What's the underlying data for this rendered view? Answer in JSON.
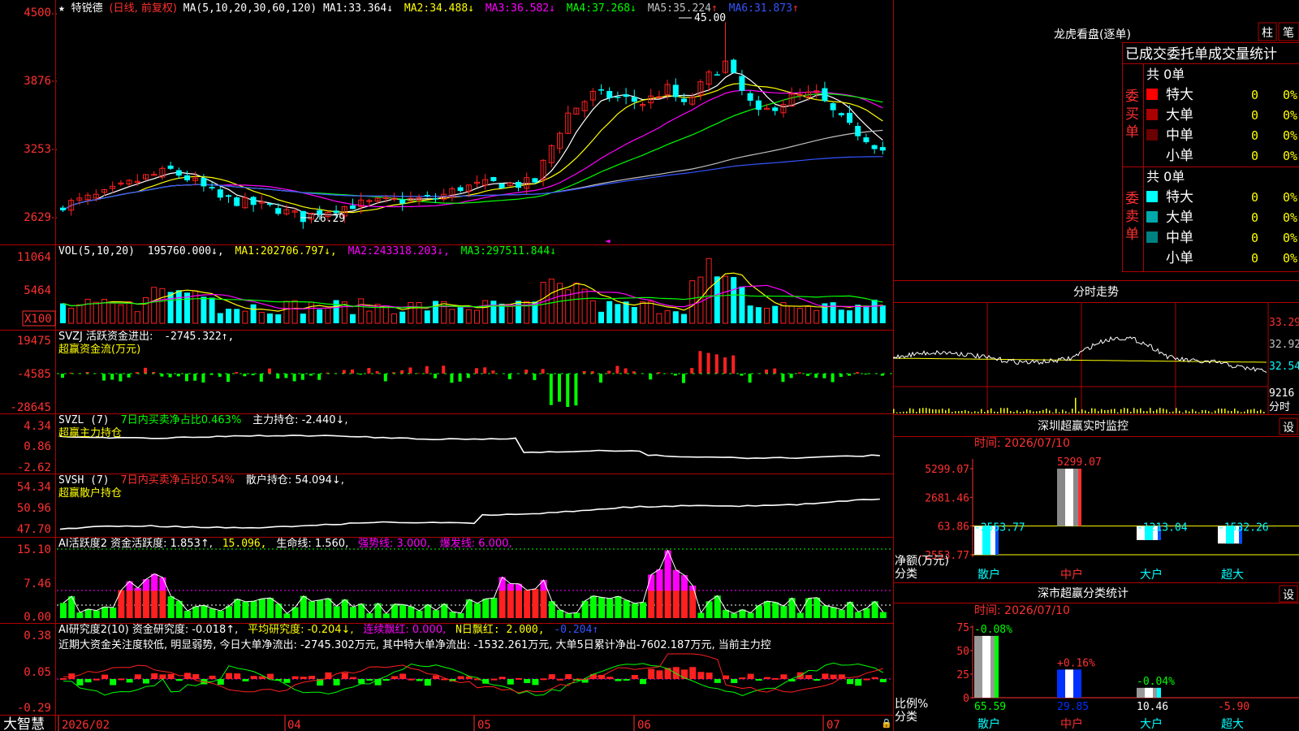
{
  "stock": {
    "name": "特锐德",
    "mode": "(日线, 前复权)",
    "ma_header": "MA(5,10,20,30,60,120)",
    "ma": [
      {
        "label": "MA1:",
        "value": "33.364",
        "dir": "↓",
        "color": "#ffffff"
      },
      {
        "label": "MA2:",
        "value": "34.488",
        "dir": "↓",
        "color": "#ffff00"
      },
      {
        "label": "MA3:",
        "value": "36.582",
        "dir": "↓",
        "color": "#ff00ff"
      },
      {
        "label": "MA4:",
        "value": "37.268",
        "dir": "↓",
        "color": "#00ff00"
      },
      {
        "label": "MA5:",
        "value": "35.224",
        "dir": "↑",
        "color": "#c0c0c0"
      },
      {
        "label": "MA6:",
        "value": "31.873",
        "dir": "↑",
        "color": "#3355ff"
      }
    ],
    "high_label": "45.00",
    "low_label": "26.29"
  },
  "colors": {
    "up": "#ff2020",
    "down": "#00ffff",
    "grid": "#b00000",
    "axis_text": "#ff3030",
    "green": "#00ff00",
    "magenta": "#ff00ff",
    "yellow": "#ffff00"
  },
  "axis": {
    "price_ticks": [
      "4500",
      "3876",
      "3253",
      "2629"
    ],
    "vol_ticks": [
      "11064",
      "5464",
      "X100"
    ],
    "svzj_ticks": [
      "19475",
      "-4585",
      "-28645"
    ],
    "svzl_ticks": [
      "4.34",
      "0.86",
      "-2.62"
    ],
    "svsh_ticks": [
      "54.34",
      "50.96",
      "47.70"
    ],
    "ai_ticks": [
      "15.10",
      "7.46",
      "0.00"
    ],
    "air_ticks": [
      "0.38",
      "0.05",
      "-0.29"
    ],
    "dates": [
      "2026/02",
      "04",
      "05",
      "06",
      "07"
    ]
  },
  "panels": {
    "vol": {
      "head": "VOL(5,10,20)",
      "value": "195760.000↓,",
      "ma": [
        {
          "label": "MA1:",
          "value": "202706.797↓,",
          "color": "#ffff00"
        },
        {
          "label": "MA2:",
          "value": "243318.203↓,",
          "color": "#ff00ff"
        },
        {
          "label": "MA3:",
          "value": "297511.844↓",
          "color": "#00ff00"
        }
      ]
    },
    "svzj": {
      "head": "SVZJ  活跃资金进出:",
      "value": "-2745.322↑,",
      "sub": "超赢资金流(万元)"
    },
    "svzl": {
      "head": "SVZL (7)",
      "mid": "7日内买卖净占比0.463%",
      "tail": "主力持仓: -2.440↓,",
      "sub": "超赢主力持仓"
    },
    "svsh": {
      "head": "SVSH (7)",
      "mid": "7日内买卖净占比0.54%",
      "tail": "散户持仓: 54.094↓,",
      "sub": "超赢散户持仓"
    },
    "ai": {
      "head": "AI活跃度2 资金活跃度: 1.853↑,",
      "v2": "15.096,",
      "life": "生命线: 1.560,",
      "strong": "强势线: 3.000,",
      "burst": "爆发线: 6.000,"
    },
    "air": {
      "head": "AI研究度2(10) 资金研究度: -0.018↑,",
      "avg": "平均研究度: -0.204↓,",
      "red": "连续飘红: 0.000,",
      "nred": "N日飘红: 2.000,",
      "last": "-0.204↑",
      "comment": "近期大资金关注度较低, 明显弱势, 今日大单净流出: -2745.302万元, 其中特大单净流出: -1532.261万元, 大单5日累计净出-7602.187万元, 当前主力控"
    }
  },
  "brand": "大智慧",
  "right": {
    "lh_title": "龙虎看盘(逐单)",
    "btn_zhu": "柱",
    "btn_bi": "笔",
    "tabs": "已成交委托单成交量统计",
    "buy_label": "委买单",
    "sell_label": "委卖单",
    "buy_total": "共 0单",
    "sell_total": "共 0单",
    "buy_rows": [
      {
        "name": "特大",
        "count": "0",
        "pct": "0%",
        "color": "#ff0000"
      },
      {
        "name": "大单",
        "count": "0",
        "pct": "0%",
        "color": "#aa0000"
      },
      {
        "name": "中单",
        "count": "0",
        "pct": "0%",
        "color": "#6a0000"
      },
      {
        "name": "小单",
        "count": "0",
        "pct": "0%",
        "color": ""
      }
    ],
    "sell_rows": [
      {
        "name": "特大",
        "count": "0",
        "pct": "0%",
        "color": "#00ffff"
      },
      {
        "name": "大单",
        "count": "0",
        "pct": "0%",
        "color": "#00aaaa"
      },
      {
        "name": "中单",
        "count": "0",
        "pct": "0%",
        "color": "#008080"
      },
      {
        "name": "小单",
        "count": "0",
        "pct": "0%",
        "color": ""
      }
    ],
    "intraday_title": "分时走势",
    "intraday_ticks": [
      "33.29",
      "32.92",
      "32.54",
      "9216",
      "分时"
    ],
    "monitor_title": "深圳超赢实时监控",
    "monitor_time": "时间: 2026/07/10",
    "set_label": "设",
    "monitor_ticks": [
      "5299.07",
      "2681.46",
      "63.86",
      "-2553.77"
    ],
    "monitor_ylabel1": "净额(万元)",
    "monitor_ylabel2": "分类",
    "categories": [
      "散户",
      "中户",
      "大户",
      "超大"
    ],
    "stats_title": "深市超赢分类统计",
    "stats_time": "时间: 2026/07/10",
    "stats_ticks": [
      "75",
      "50",
      "25",
      "0"
    ],
    "stats_ylabel1": "比例%",
    "stats_ylabel2": "分类"
  },
  "chart_data": [
    {
      "type": "bar",
      "title": "深圳超赢实时监控",
      "ylabel": "净额(万元)",
      "categories": [
        "散户",
        "中户",
        "大户",
        "超大"
      ],
      "values": [
        -2553.77,
        5299.07,
        -1213.04,
        -1532.26
      ],
      "labels": [
        "-2553.77",
        "5299.07",
        "-1213.04",
        "-1532.26"
      ],
      "ylim": [
        -2553.77,
        5299.07
      ]
    },
    {
      "type": "bar",
      "title": "深市超赢分类统计",
      "ylabel": "比例%",
      "categories": [
        "散户",
        "中户",
        "大户",
        "超大"
      ],
      "values": [
        65.59,
        29.85,
        10.46,
        -5.9
      ],
      "changes": [
        "-0.08%",
        "+0.16%",
        "-0.04%",
        ""
      ],
      "labels": [
        "65.59",
        "29.85",
        "10.46",
        "-5.90"
      ],
      "ylim": [
        0,
        75
      ]
    }
  ]
}
